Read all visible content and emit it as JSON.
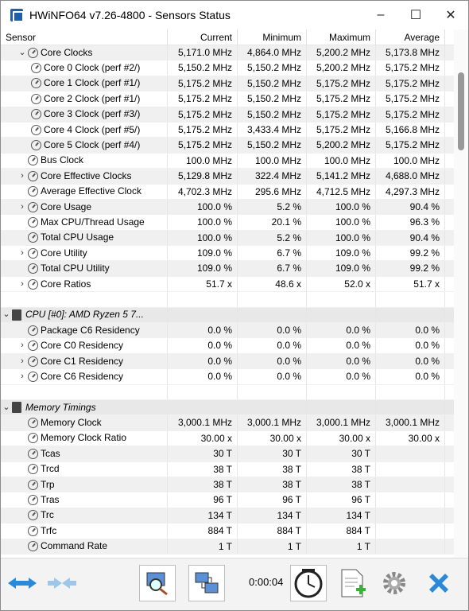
{
  "window": {
    "title": "HWiNFO64 v7.26-4800 - Sensors Status"
  },
  "columns": {
    "sensor": "Sensor",
    "current": "Current",
    "minimum": "Minimum",
    "maximum": "Maximum",
    "average": "Average"
  },
  "rows": [
    {
      "indent": 1,
      "chev": "⌄",
      "icon": "sensor",
      "label": "Core Clocks",
      "cur": "5,171.0 MHz",
      "min": "4,864.0 MHz",
      "max": "5,200.2 MHz",
      "avg": "5,173.8 MHz"
    },
    {
      "indent": 2,
      "chev": "",
      "icon": "sensor",
      "label": "Core 0 Clock (perf #2/)",
      "cur": "5,150.2 MHz",
      "min": "5,150.2 MHz",
      "max": "5,200.2 MHz",
      "avg": "5,175.2 MHz"
    },
    {
      "indent": 2,
      "chev": "",
      "icon": "sensor",
      "label": "Core 1 Clock (perf #1/)",
      "cur": "5,175.2 MHz",
      "min": "5,150.2 MHz",
      "max": "5,175.2 MHz",
      "avg": "5,175.2 MHz"
    },
    {
      "indent": 2,
      "chev": "",
      "icon": "sensor",
      "label": "Core 2 Clock (perf #1/)",
      "cur": "5,175.2 MHz",
      "min": "5,150.2 MHz",
      "max": "5,175.2 MHz",
      "avg": "5,175.2 MHz"
    },
    {
      "indent": 2,
      "chev": "",
      "icon": "sensor",
      "label": "Core 3 Clock (perf #3/)",
      "cur": "5,175.2 MHz",
      "min": "5,150.2 MHz",
      "max": "5,175.2 MHz",
      "avg": "5,175.2 MHz"
    },
    {
      "indent": 2,
      "chev": "",
      "icon": "sensor",
      "label": "Core 4 Clock (perf #5/)",
      "cur": "5,175.2 MHz",
      "min": "3,433.4 MHz",
      "max": "5,175.2 MHz",
      "avg": "5,166.8 MHz"
    },
    {
      "indent": 2,
      "chev": "",
      "icon": "sensor",
      "label": "Core 5 Clock (perf #4/)",
      "cur": "5,175.2 MHz",
      "min": "5,150.2 MHz",
      "max": "5,200.2 MHz",
      "avg": "5,175.2 MHz"
    },
    {
      "indent": 0,
      "chev": "",
      "icon": "sensor",
      "label": "Bus Clock",
      "cur": "100.0 MHz",
      "min": "100.0 MHz",
      "max": "100.0 MHz",
      "avg": "100.0 MHz"
    },
    {
      "indent": 1,
      "chev": "›",
      "icon": "sensor",
      "label": "Core Effective Clocks",
      "cur": "5,129.8 MHz",
      "min": "322.4 MHz",
      "max": "5,141.2 MHz",
      "avg": "4,688.0 MHz"
    },
    {
      "indent": 0,
      "chev": "",
      "icon": "sensor",
      "label": "Average Effective Clock",
      "cur": "4,702.3 MHz",
      "min": "295.6 MHz",
      "max": "4,712.5 MHz",
      "avg": "4,297.3 MHz"
    },
    {
      "indent": 1,
      "chev": "›",
      "icon": "sensor",
      "label": "Core Usage",
      "cur": "100.0 %",
      "min": "5.2 %",
      "max": "100.0 %",
      "avg": "90.4 %"
    },
    {
      "indent": 0,
      "chev": "",
      "icon": "sensor",
      "label": "Max CPU/Thread Usage",
      "cur": "100.0 %",
      "min": "20.1 %",
      "max": "100.0 %",
      "avg": "96.3 %"
    },
    {
      "indent": 0,
      "chev": "",
      "icon": "sensor",
      "label": "Total CPU Usage",
      "cur": "100.0 %",
      "min": "5.2 %",
      "max": "100.0 %",
      "avg": "90.4 %"
    },
    {
      "indent": 1,
      "chev": "›",
      "icon": "sensor",
      "label": "Core Utility",
      "cur": "109.0 %",
      "min": "6.7 %",
      "max": "109.0 %",
      "avg": "99.2 %"
    },
    {
      "indent": 0,
      "chev": "",
      "icon": "sensor",
      "label": "Total CPU Utility",
      "cur": "109.0 %",
      "min": "6.7 %",
      "max": "109.0 %",
      "avg": "99.2 %"
    },
    {
      "indent": 1,
      "chev": "›",
      "icon": "sensor",
      "label": "Core Ratios",
      "cur": "51.7 x",
      "min": "48.6 x",
      "max": "52.0 x",
      "avg": "51.7 x"
    },
    {
      "blank": true
    },
    {
      "group": true,
      "chev": "⌄",
      "label": "CPU [#0]: AMD Ryzen 5 7..."
    },
    {
      "indent": 0,
      "chev": "",
      "icon": "sensor",
      "label": "Package C6 Residency",
      "cur": "0.0 %",
      "min": "0.0 %",
      "max": "0.0 %",
      "avg": "0.0 %"
    },
    {
      "indent": 1,
      "chev": "›",
      "icon": "sensor",
      "label": "Core C0 Residency",
      "cur": "0.0 %",
      "min": "0.0 %",
      "max": "0.0 %",
      "avg": "0.0 %"
    },
    {
      "indent": 1,
      "chev": "›",
      "icon": "sensor",
      "label": "Core C1 Residency",
      "cur": "0.0 %",
      "min": "0.0 %",
      "max": "0.0 %",
      "avg": "0.0 %"
    },
    {
      "indent": 1,
      "chev": "›",
      "icon": "sensor",
      "label": "Core C6 Residency",
      "cur": "0.0 %",
      "min": "0.0 %",
      "max": "0.0 %",
      "avg": "0.0 %"
    },
    {
      "blank": true
    },
    {
      "group": true,
      "chev": "⌄",
      "label": "Memory Timings"
    },
    {
      "indent": 0,
      "chev": "",
      "icon": "sensor",
      "label": "Memory Clock",
      "cur": "3,000.1 MHz",
      "min": "3,000.1 MHz",
      "max": "3,000.1 MHz",
      "avg": "3,000.1 MHz"
    },
    {
      "indent": 0,
      "chev": "",
      "icon": "sensor",
      "label": "Memory Clock Ratio",
      "cur": "30.00 x",
      "min": "30.00 x",
      "max": "30.00 x",
      "avg": "30.00 x"
    },
    {
      "indent": 0,
      "chev": "",
      "icon": "sensor",
      "label": "Tcas",
      "cur": "30 T",
      "min": "30 T",
      "max": "30 T",
      "avg": ""
    },
    {
      "indent": 0,
      "chev": "",
      "icon": "sensor",
      "label": "Trcd",
      "cur": "38 T",
      "min": "38 T",
      "max": "38 T",
      "avg": ""
    },
    {
      "indent": 0,
      "chev": "",
      "icon": "sensor",
      "label": "Trp",
      "cur": "38 T",
      "min": "38 T",
      "max": "38 T",
      "avg": ""
    },
    {
      "indent": 0,
      "chev": "",
      "icon": "sensor",
      "label": "Tras",
      "cur": "96 T",
      "min": "96 T",
      "max": "96 T",
      "avg": ""
    },
    {
      "indent": 0,
      "chev": "",
      "icon": "sensor",
      "label": "Trc",
      "cur": "134 T",
      "min": "134 T",
      "max": "134 T",
      "avg": ""
    },
    {
      "indent": 0,
      "chev": "",
      "icon": "sensor",
      "label": "Trfc",
      "cur": "884 T",
      "min": "884 T",
      "max": "884 T",
      "avg": ""
    },
    {
      "indent": 0,
      "chev": "",
      "icon": "sensor",
      "label": "Command Rate",
      "cur": "1 T",
      "min": "1 T",
      "max": "1 T",
      "avg": ""
    }
  ],
  "toolbar": {
    "timer": "0:00:04"
  },
  "colors": {
    "accent_blue": "#2a8ad8",
    "green_plus": "#3fae3f"
  }
}
